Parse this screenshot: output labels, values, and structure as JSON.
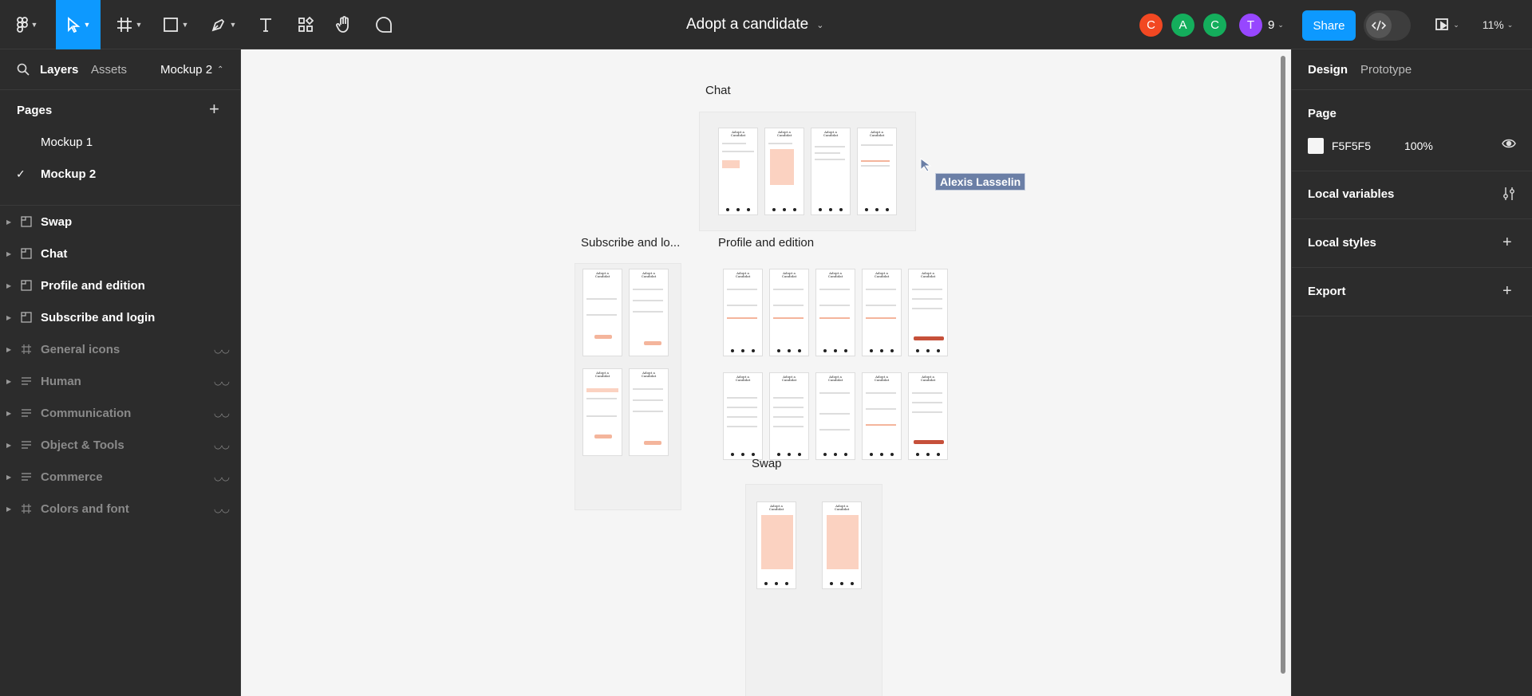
{
  "toolbar": {
    "doc_title": "Adopt a candidate",
    "share_label": "Share",
    "avatar_count": "9",
    "zoom": "11%",
    "avatars": [
      {
        "letter": "C",
        "color": "#f24822"
      },
      {
        "letter": "A",
        "color": "#14ae5c"
      },
      {
        "letter": "C",
        "color": "#14ae5c"
      },
      {
        "letter": "T",
        "color": "#9747ff"
      }
    ]
  },
  "left_panel": {
    "tabs": {
      "layers": "Layers",
      "assets": "Assets",
      "page_switch": "Mockup 2"
    },
    "pages_heading": "Pages",
    "pages": [
      {
        "name": "Mockup 1",
        "selected": false
      },
      {
        "name": "Mockup 2",
        "selected": true
      }
    ],
    "layers": [
      {
        "name": "Swap",
        "type": "section",
        "hidden": false
      },
      {
        "name": "Chat",
        "type": "section",
        "hidden": false
      },
      {
        "name": "Profile and edition",
        "type": "section",
        "hidden": false
      },
      {
        "name": "Subscribe and login",
        "type": "section",
        "hidden": false
      },
      {
        "name": "General icons",
        "type": "frame",
        "hidden": true
      },
      {
        "name": "Human",
        "type": "text",
        "hidden": true
      },
      {
        "name": "Communication",
        "type": "text",
        "hidden": true
      },
      {
        "name": "Object & Tools",
        "type": "text",
        "hidden": true
      },
      {
        "name": "Commerce",
        "type": "text",
        "hidden": true
      },
      {
        "name": "Colors and font",
        "type": "frame",
        "hidden": true
      }
    ]
  },
  "canvas": {
    "sections": {
      "chat": "Chat",
      "subscribe": "Subscribe and lo...",
      "profile": "Profile and edition",
      "swap": "Swap"
    },
    "cursor_user": "Alexis Lasselin",
    "bg_color": "#f5f5f5"
  },
  "right_panel": {
    "tabs": {
      "design": "Design",
      "prototype": "Prototype"
    },
    "page_heading": "Page",
    "page_color": "F5F5F5",
    "page_opacity": "100%",
    "local_variables": "Local variables",
    "local_styles": "Local styles",
    "export": "Export"
  },
  "help_label": "?"
}
